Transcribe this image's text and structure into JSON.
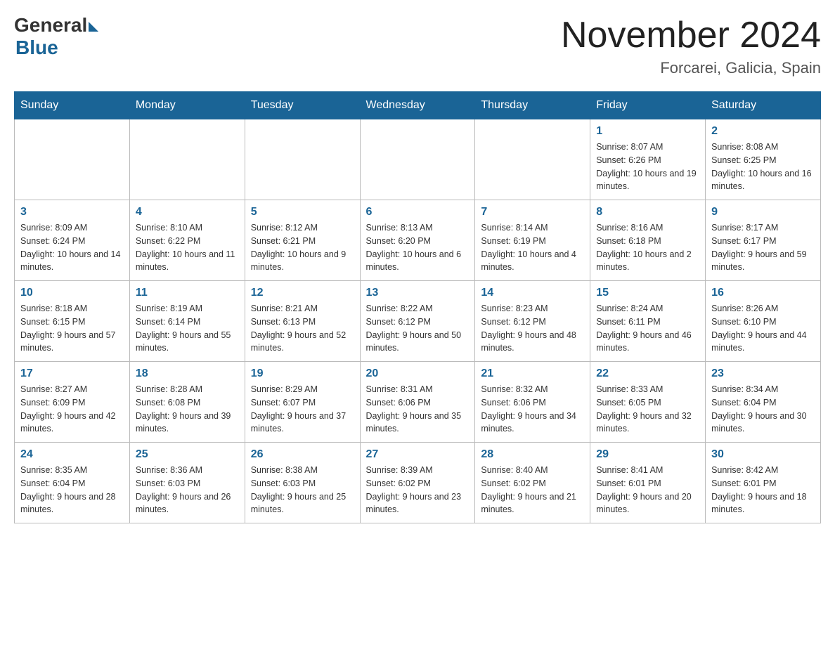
{
  "header": {
    "logo_general": "General",
    "logo_blue": "Blue",
    "month_title": "November 2024",
    "location": "Forcarei, Galicia, Spain"
  },
  "days_of_week": [
    "Sunday",
    "Monday",
    "Tuesday",
    "Wednesday",
    "Thursday",
    "Friday",
    "Saturday"
  ],
  "weeks": [
    [
      {
        "day": "",
        "info": ""
      },
      {
        "day": "",
        "info": ""
      },
      {
        "day": "",
        "info": ""
      },
      {
        "day": "",
        "info": ""
      },
      {
        "day": "",
        "info": ""
      },
      {
        "day": "1",
        "info": "Sunrise: 8:07 AM\nSunset: 6:26 PM\nDaylight: 10 hours and 19 minutes."
      },
      {
        "day": "2",
        "info": "Sunrise: 8:08 AM\nSunset: 6:25 PM\nDaylight: 10 hours and 16 minutes."
      }
    ],
    [
      {
        "day": "3",
        "info": "Sunrise: 8:09 AM\nSunset: 6:24 PM\nDaylight: 10 hours and 14 minutes."
      },
      {
        "day": "4",
        "info": "Sunrise: 8:10 AM\nSunset: 6:22 PM\nDaylight: 10 hours and 11 minutes."
      },
      {
        "day": "5",
        "info": "Sunrise: 8:12 AM\nSunset: 6:21 PM\nDaylight: 10 hours and 9 minutes."
      },
      {
        "day": "6",
        "info": "Sunrise: 8:13 AM\nSunset: 6:20 PM\nDaylight: 10 hours and 6 minutes."
      },
      {
        "day": "7",
        "info": "Sunrise: 8:14 AM\nSunset: 6:19 PM\nDaylight: 10 hours and 4 minutes."
      },
      {
        "day": "8",
        "info": "Sunrise: 8:16 AM\nSunset: 6:18 PM\nDaylight: 10 hours and 2 minutes."
      },
      {
        "day": "9",
        "info": "Sunrise: 8:17 AM\nSunset: 6:17 PM\nDaylight: 9 hours and 59 minutes."
      }
    ],
    [
      {
        "day": "10",
        "info": "Sunrise: 8:18 AM\nSunset: 6:15 PM\nDaylight: 9 hours and 57 minutes."
      },
      {
        "day": "11",
        "info": "Sunrise: 8:19 AM\nSunset: 6:14 PM\nDaylight: 9 hours and 55 minutes."
      },
      {
        "day": "12",
        "info": "Sunrise: 8:21 AM\nSunset: 6:13 PM\nDaylight: 9 hours and 52 minutes."
      },
      {
        "day": "13",
        "info": "Sunrise: 8:22 AM\nSunset: 6:12 PM\nDaylight: 9 hours and 50 minutes."
      },
      {
        "day": "14",
        "info": "Sunrise: 8:23 AM\nSunset: 6:12 PM\nDaylight: 9 hours and 48 minutes."
      },
      {
        "day": "15",
        "info": "Sunrise: 8:24 AM\nSunset: 6:11 PM\nDaylight: 9 hours and 46 minutes."
      },
      {
        "day": "16",
        "info": "Sunrise: 8:26 AM\nSunset: 6:10 PM\nDaylight: 9 hours and 44 minutes."
      }
    ],
    [
      {
        "day": "17",
        "info": "Sunrise: 8:27 AM\nSunset: 6:09 PM\nDaylight: 9 hours and 42 minutes."
      },
      {
        "day": "18",
        "info": "Sunrise: 8:28 AM\nSunset: 6:08 PM\nDaylight: 9 hours and 39 minutes."
      },
      {
        "day": "19",
        "info": "Sunrise: 8:29 AM\nSunset: 6:07 PM\nDaylight: 9 hours and 37 minutes."
      },
      {
        "day": "20",
        "info": "Sunrise: 8:31 AM\nSunset: 6:06 PM\nDaylight: 9 hours and 35 minutes."
      },
      {
        "day": "21",
        "info": "Sunrise: 8:32 AM\nSunset: 6:06 PM\nDaylight: 9 hours and 34 minutes."
      },
      {
        "day": "22",
        "info": "Sunrise: 8:33 AM\nSunset: 6:05 PM\nDaylight: 9 hours and 32 minutes."
      },
      {
        "day": "23",
        "info": "Sunrise: 8:34 AM\nSunset: 6:04 PM\nDaylight: 9 hours and 30 minutes."
      }
    ],
    [
      {
        "day": "24",
        "info": "Sunrise: 8:35 AM\nSunset: 6:04 PM\nDaylight: 9 hours and 28 minutes."
      },
      {
        "day": "25",
        "info": "Sunrise: 8:36 AM\nSunset: 6:03 PM\nDaylight: 9 hours and 26 minutes."
      },
      {
        "day": "26",
        "info": "Sunrise: 8:38 AM\nSunset: 6:03 PM\nDaylight: 9 hours and 25 minutes."
      },
      {
        "day": "27",
        "info": "Sunrise: 8:39 AM\nSunset: 6:02 PM\nDaylight: 9 hours and 23 minutes."
      },
      {
        "day": "28",
        "info": "Sunrise: 8:40 AM\nSunset: 6:02 PM\nDaylight: 9 hours and 21 minutes."
      },
      {
        "day": "29",
        "info": "Sunrise: 8:41 AM\nSunset: 6:01 PM\nDaylight: 9 hours and 20 minutes."
      },
      {
        "day": "30",
        "info": "Sunrise: 8:42 AM\nSunset: 6:01 PM\nDaylight: 9 hours and 18 minutes."
      }
    ]
  ]
}
